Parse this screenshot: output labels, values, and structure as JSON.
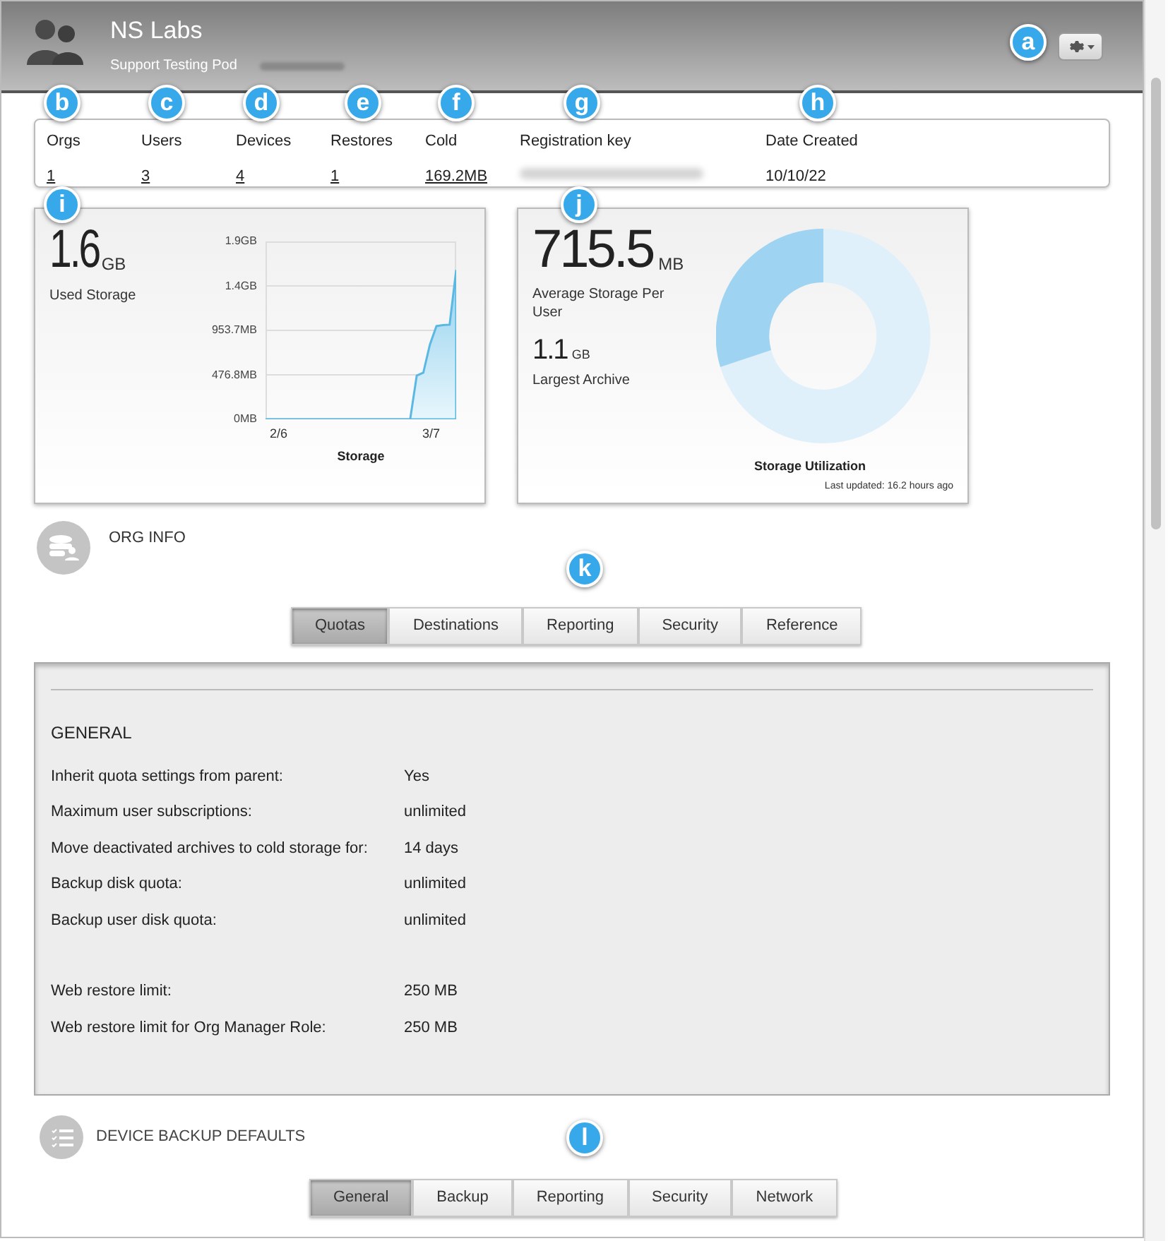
{
  "header": {
    "title": "NS Labs",
    "subtitle": "Support Testing Pod"
  },
  "stats": [
    {
      "label": "Orgs",
      "value": "1",
      "kind": "link"
    },
    {
      "label": "Users",
      "value": "3",
      "kind": "link"
    },
    {
      "label": "Devices",
      "value": "4",
      "kind": "link"
    },
    {
      "label": "Restores",
      "value": "1",
      "kind": "link"
    },
    {
      "label": "Cold",
      "value": "169.2MB",
      "kind": "link"
    },
    {
      "label": "Registration key",
      "kind": "hidden"
    },
    {
      "label": "Date Created",
      "value": "10/10/22",
      "kind": "plain"
    }
  ],
  "used_storage": {
    "value": "1.6",
    "unit": "GB",
    "label": "Used Storage",
    "chart": {
      "title": "Storage",
      "y_labels": [
        "1.9GB",
        "1.4GB",
        "953.7MB",
        "476.8MB",
        "0MB"
      ],
      "x_labels": [
        "2/6",
        "3/7"
      ]
    }
  },
  "average_storage": {
    "value": "715.5",
    "unit": "MB",
    "label": "Average Storage Per User",
    "largest_value": "1.1",
    "largest_unit": "GB",
    "largest_label": "Largest Archive",
    "donut_title": "Storage Utilization",
    "updated": "Last updated: 16.2 hours ago"
  },
  "org_info": {
    "title": "ORG INFO",
    "tabs": [
      {
        "label": "Quotas",
        "selected": true
      },
      {
        "label": "Destinations",
        "selected": false
      },
      {
        "label": "Reporting",
        "selected": false
      },
      {
        "label": "Security",
        "selected": false
      },
      {
        "label": "Reference",
        "selected": false
      }
    ],
    "section": "GENERAL",
    "rows": [
      {
        "label": "Inherit quota settings from parent:",
        "value": "Yes"
      },
      {
        "label": "Maximum user subscriptions:",
        "value": "unlimited"
      },
      {
        "label": "Move deactivated archives to cold storage for:",
        "value": "14 days"
      },
      {
        "label": "Backup disk quota:",
        "value": "unlimited"
      },
      {
        "label": "Backup user disk quota:",
        "value": "unlimited",
        "gap_after": true
      },
      {
        "label": "Web restore limit:",
        "value": "250 MB"
      },
      {
        "label": "Web restore limit for Org Manager Role:",
        "value": "250 MB"
      }
    ]
  },
  "device_backup": {
    "title": "DEVICE BACKUP DEFAULTS",
    "tabs": [
      {
        "label": "General",
        "selected": true
      },
      {
        "label": "Backup",
        "selected": false
      },
      {
        "label": "Reporting",
        "selected": false
      },
      {
        "label": "Security",
        "selected": false
      },
      {
        "label": "Network",
        "selected": false
      }
    ]
  },
  "callouts": [
    "a",
    "b",
    "c",
    "d",
    "e",
    "f",
    "g",
    "h",
    "i",
    "j",
    "k",
    "l"
  ]
}
